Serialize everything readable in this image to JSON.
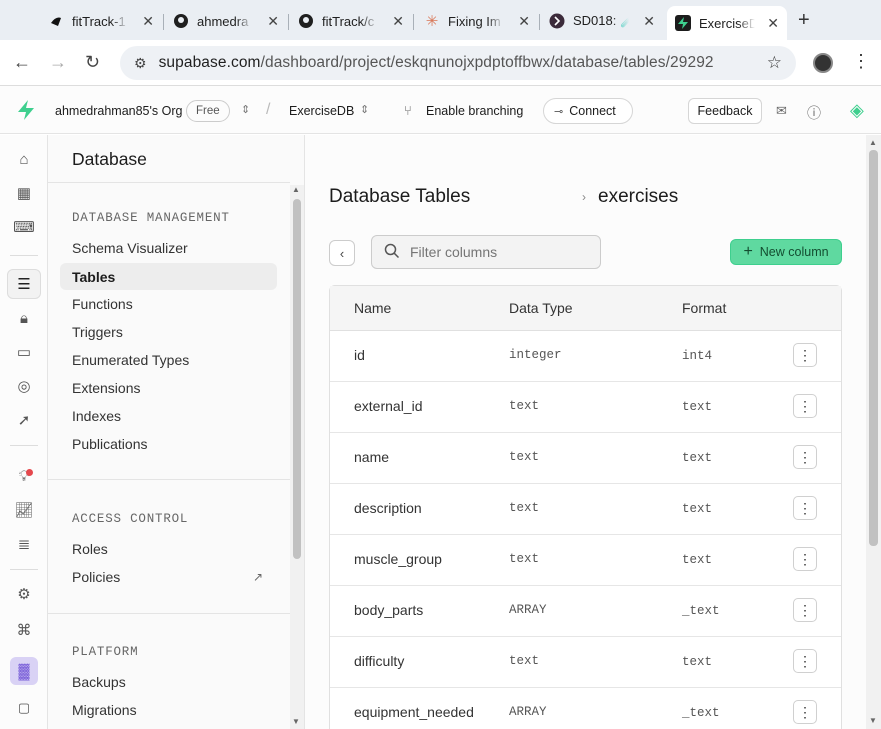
{
  "browser": {
    "tabs": [
      {
        "title": "fitTrack-1",
        "icon": "notion-icon"
      },
      {
        "title": "ahmedra",
        "icon": "github-icon"
      },
      {
        "title": "fitTrack/c",
        "icon": "github-icon"
      },
      {
        "title": "Fixing Im",
        "icon": "claude-icon"
      },
      {
        "title": "SD018: 🧪",
        "icon": "app-icon"
      },
      {
        "title": "ExerciseD",
        "icon": "supabase-icon"
      }
    ],
    "url_host": "supabase.com",
    "url_path": "/dashboard/project/eskqnunojxpdptoffbwx/database/tables/29292"
  },
  "topbar": {
    "org": "ahmedrahman85's Org",
    "plan": "Free",
    "project": "ExerciseDB",
    "branching": "Enable branching",
    "connect": "Connect",
    "feedback": "Feedback"
  },
  "sidebar": {
    "title": "Database",
    "sections": [
      {
        "heading": "DATABASE MANAGEMENT",
        "items": [
          "Schema Visualizer",
          "Tables",
          "Functions",
          "Triggers",
          "Enumerated Types",
          "Extensions",
          "Indexes",
          "Publications"
        ]
      },
      {
        "heading": "ACCESS CONTROL",
        "items": [
          "Roles",
          "Policies"
        ]
      },
      {
        "heading": "PLATFORM",
        "items": [
          "Backups",
          "Migrations"
        ]
      }
    ],
    "active_item": "Tables"
  },
  "main": {
    "title": "Database Tables",
    "table_name": "exercises",
    "filter_placeholder": "Filter columns",
    "new_column": "New column",
    "headers": [
      "Name",
      "Data Type",
      "Format"
    ],
    "rows": [
      {
        "name": "id",
        "type": "integer",
        "format": "int4"
      },
      {
        "name": "external_id",
        "type": "text",
        "format": "text"
      },
      {
        "name": "name",
        "type": "text",
        "format": "text"
      },
      {
        "name": "description",
        "type": "text",
        "format": "text"
      },
      {
        "name": "muscle_group",
        "type": "text",
        "format": "text"
      },
      {
        "name": "body_parts",
        "type": "ARRAY",
        "format": "_text"
      },
      {
        "name": "difficulty",
        "type": "text",
        "format": "text"
      },
      {
        "name": "equipment_needed",
        "type": "ARRAY",
        "format": "_text"
      }
    ]
  },
  "colors": {
    "brand": "#3ecf8e",
    "new_column_bg": "#5fd9a0"
  }
}
